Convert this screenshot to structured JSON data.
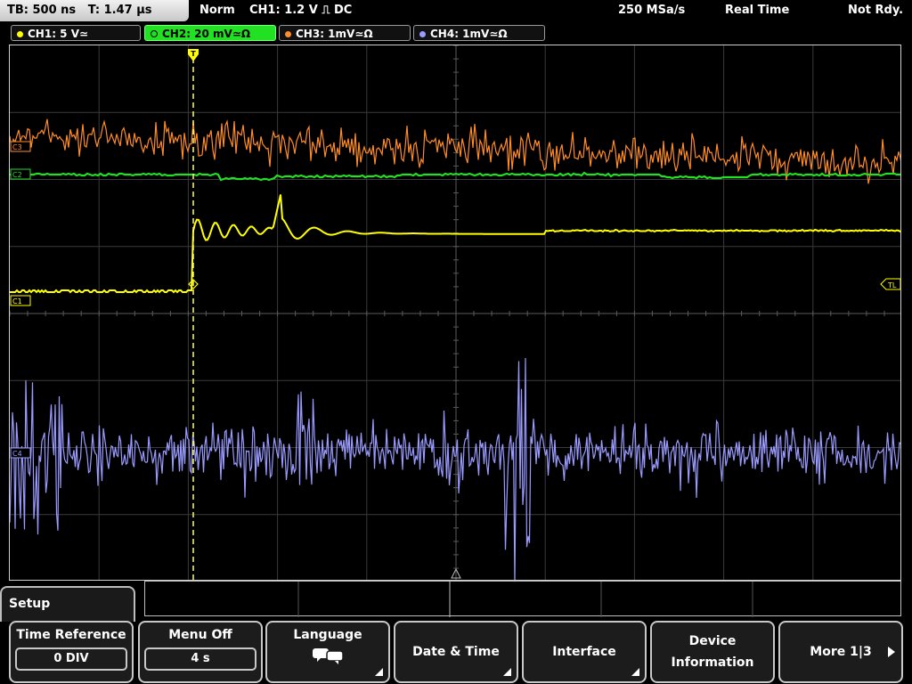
{
  "status": {
    "timebase": "TB: 500 ns",
    "trigger_time": "T: 1.47 µs",
    "trigger_mode": "Norm",
    "trigger_info": "CH1: 1.2 V ⎍ DC",
    "sample_rate": "250 MSa/s",
    "acq_mode": "Real Time",
    "state": "Not Rdy."
  },
  "channels": [
    {
      "label": "CH1: 5 V≃",
      "color": "#ffff00"
    },
    {
      "label": "CH2: 20 mV≃Ω",
      "color": "#22e022"
    },
    {
      "label": "CH3: 1mV≃Ω",
      "color": "#ff8c2a"
    },
    {
      "label": "CH4: 1mV≃Ω",
      "color": "#9a9aff"
    }
  ],
  "markers": {
    "c1": "C1",
    "c2": "C2",
    "c3": "C3",
    "c4": "C4",
    "trigger_level": "TL",
    "trigger_pos": "T"
  },
  "menu": {
    "title": "Setup",
    "keys": [
      {
        "label": "Time Reference",
        "value": "0 DIV"
      },
      {
        "label": "Menu Off",
        "value": "4 s"
      },
      {
        "label": "Language",
        "icon": "speech-bubbles-icon"
      },
      {
        "label": "Date & Time"
      },
      {
        "label": "Interface"
      },
      {
        "label_line1": "Device",
        "label_line2": "Information"
      },
      {
        "label": "More 1|3"
      }
    ]
  }
}
